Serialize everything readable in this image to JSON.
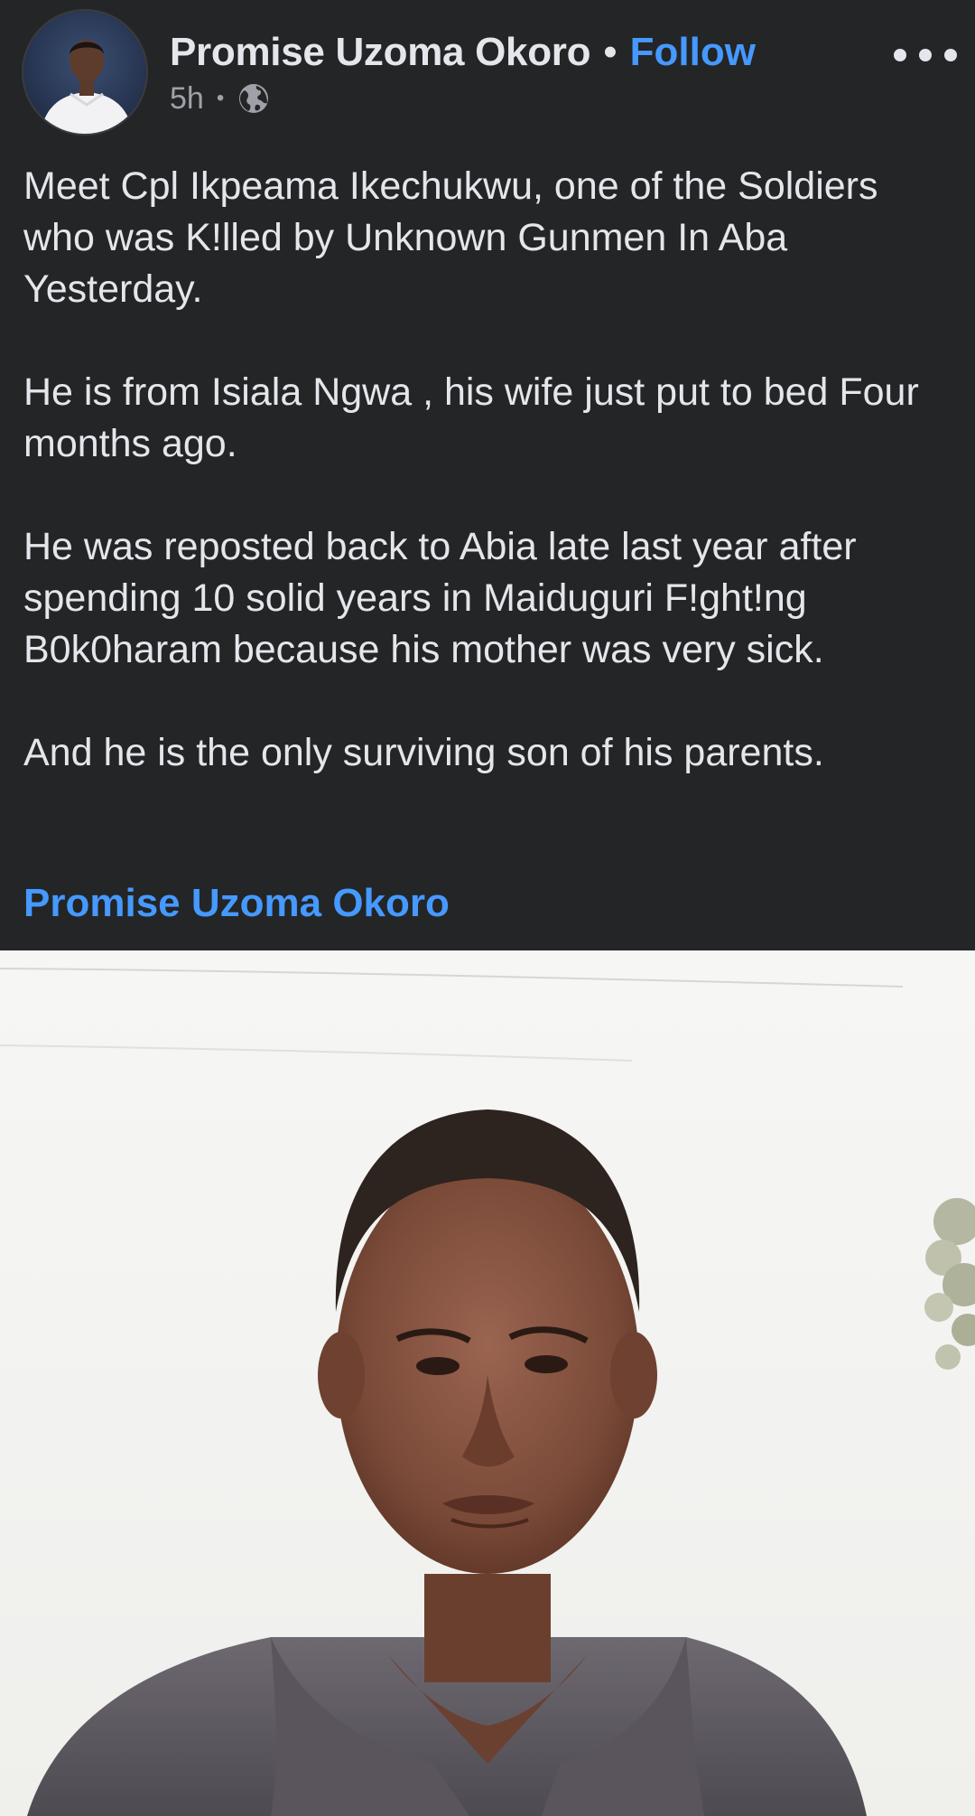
{
  "post": {
    "author_name": "Promise Uzoma Okoro",
    "follow_label": "Follow",
    "timestamp": "5h",
    "privacy_icon": "globe-icon",
    "more_icon": "more-options-icon",
    "paragraphs": [
      "Meet Cpl Ikpeama Ikechukwu, one of the Soldiers who was K!lled by Unknown Gunmen In Aba Yesterday.",
      "He is from Isiala Ngwa , his wife just put to bed Four months ago.",
      "He was reposted back to Abia late last year after spending 10 solid years in Maiduguri F!ght!ng B0k0haram because his mother was very sick.",
      "And he is  the only surviving son of his parents."
    ],
    "tagged_name": "Promise Uzoma Okoro"
  },
  "colors": {
    "background": "#242526",
    "text": "#e4e6eb",
    "secondary_text": "#9ea2a8",
    "link": "#4599ff",
    "photo_background": "#f3f3f2"
  }
}
